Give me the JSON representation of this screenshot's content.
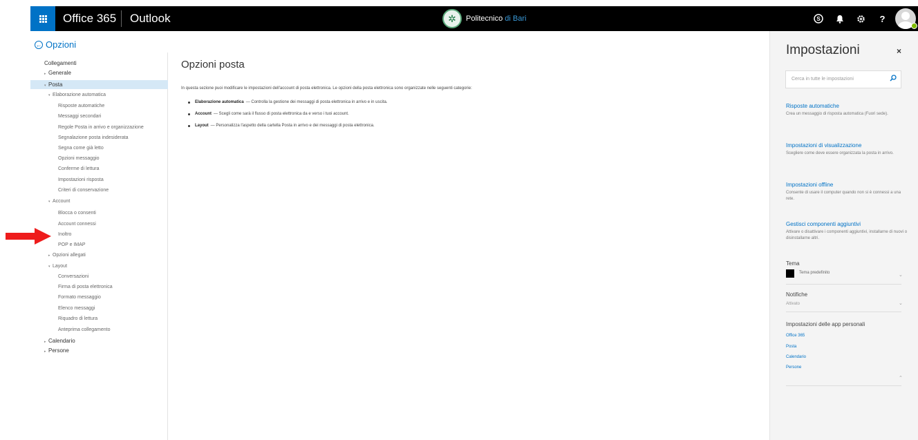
{
  "topbar": {
    "brand": "Office 365",
    "app": "Outlook",
    "org_name": "Politecnico",
    "org_suffix": "di Bari",
    "skype_label": "S",
    "bell_label": "♪",
    "gear_label": "⚙",
    "help_label": "?"
  },
  "back": {
    "label": "Opzioni"
  },
  "nav": {
    "items": [
      {
        "label": "Collegamenti"
      },
      {
        "label": "Generale",
        "caret": "▸"
      },
      {
        "label": "Posta",
        "caret": "▾"
      },
      {
        "label": "Elaborazione automatica",
        "caret": "▾"
      },
      {
        "label": "Risposte automatiche"
      },
      {
        "label": "Messaggi secondari"
      },
      {
        "label": "Regole Posta in arrivo e organizzazione"
      },
      {
        "label": "Segnalazione posta indesiderata"
      },
      {
        "label": "Segna come già letto"
      },
      {
        "label": "Opzioni messaggio"
      },
      {
        "label": "Conferme di lettura"
      },
      {
        "label": "Impostazioni risposta"
      },
      {
        "label": "Criteri di conservazione"
      },
      {
        "label": "Account",
        "caret": "▾"
      },
      {
        "label": "Blocca o consenti"
      },
      {
        "label": "Account connessi"
      },
      {
        "label": "Inoltro"
      },
      {
        "label": "POP e IMAP"
      },
      {
        "label": "Opzioni allegati",
        "caret": "▸"
      },
      {
        "label": "Layout",
        "caret": "▾"
      },
      {
        "label": "Conversazioni"
      },
      {
        "label": "Firma di posta elettronica"
      },
      {
        "label": "Formato messaggio"
      },
      {
        "label": "Elenco messaggi"
      },
      {
        "label": "Riquadro di lettura"
      },
      {
        "label": "Anteprima collegamento"
      },
      {
        "label": "Calendario",
        "caret": "▸"
      },
      {
        "label": "Persone",
        "caret": "▸"
      }
    ]
  },
  "main": {
    "title": "Opzioni posta",
    "intro": "In questa sezione puoi modificare le impostazioni dell'account di posta elettronica. Le opzioni della posta elettronica sono organizzate nelle seguenti categorie:",
    "bullets": [
      {
        "term": "Elaborazione automatica",
        "desc": "— Controlla la gestione dei messaggi di posta elettronica in arrivo e in uscita."
      },
      {
        "term": "Account",
        "desc": "— Scegli come sarà il flusso di posta elettronica da e verso i tuoi account."
      },
      {
        "term": "Layout",
        "desc": "— Personalizza l'aspetto della cartella Posta in arrivo e dei messaggi di posta elettronica."
      }
    ]
  },
  "panel": {
    "title": "Impostazioni",
    "close": "×",
    "search_placeholder": "Cerca in tutte le impostazioni",
    "links": [
      {
        "title": "Risposte automatiche",
        "desc": "Crea un messaggio di risposta automatica (Fuori sede)."
      },
      {
        "title": "Impostazioni di visualizzazione",
        "desc": "Scegliere come deve essere organizzata la posta in arrivo."
      },
      {
        "title": "Impostazioni offline",
        "desc": "Consente di usare il computer quando non si è connessi a una rete."
      },
      {
        "title": "Gestisci componenti aggiuntivi",
        "desc": "Attivare o disattivare i componenti aggiuntivi, installarne di nuovi o disinstallarne altri."
      }
    ],
    "theme_heading": "Tema",
    "theme_value": "Tema predefinito",
    "notif_heading": "Notifiche",
    "notif_value": "Attivato",
    "apps_heading": "Impostazioni delle app personali",
    "apps": [
      "Office 365",
      "Posta",
      "Calendario",
      "Persone"
    ]
  },
  "colors": {
    "accent": "#0072c6",
    "topbar": "#000000",
    "selection": "#d5e8f6",
    "arrow": "#ee1c1c"
  }
}
